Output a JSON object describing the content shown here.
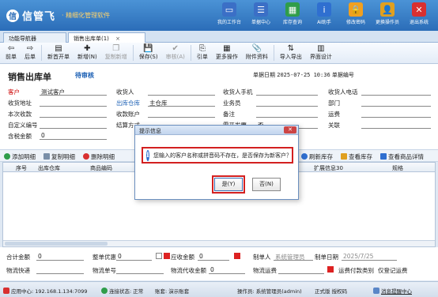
{
  "header": {
    "logo_mark": "信",
    "app_name": "信管飞",
    "tagline": "· 精细化管理软件",
    "tools": [
      {
        "label": "我的工作台",
        "icon": "monitor-icon",
        "color": "#3b6fc6",
        "glyph": "▭"
      },
      {
        "label": "单据中心",
        "icon": "list-icon",
        "color": "#3b6fc6",
        "glyph": "☰"
      },
      {
        "label": "库存查询",
        "icon": "warehouse-icon",
        "color": "#2f9d4a",
        "glyph": "▦"
      },
      {
        "label": "AI助手",
        "icon": "info-icon",
        "color": "#2f6fd0",
        "glyph": "i"
      },
      {
        "label": "修改密码",
        "icon": "lock-icon",
        "color": "#f0a020",
        "glyph": "🔒"
      },
      {
        "label": "更换操作员",
        "icon": "user-icon",
        "color": "#e0a020",
        "glyph": "👤"
      },
      {
        "label": "退出系统",
        "icon": "exit-icon",
        "color": "#d83030",
        "glyph": "✕"
      }
    ]
  },
  "tabs": [
    {
      "label": "功能导航器",
      "active": false
    },
    {
      "label": "销售出库单(1)",
      "active": true,
      "close": "×"
    }
  ],
  "toolbar": [
    {
      "label": "前单",
      "icon": "prev-icon",
      "glyph": "⇦"
    },
    {
      "label": "后单",
      "icon": "next-icon",
      "glyph": "⇨"
    },
    {
      "label": "新首开单",
      "icon": "new-doc-icon",
      "glyph": "▤"
    },
    {
      "label": "新增(N)",
      "icon": "add-icon",
      "glyph": "✚"
    },
    {
      "label": "复制新增",
      "icon": "copy-icon",
      "glyph": "❐",
      "disabled": true
    },
    {
      "label": "保存(S)",
      "icon": "save-icon",
      "glyph": "💾"
    },
    {
      "label": "审核(A)",
      "icon": "audit-icon",
      "glyph": "✔",
      "disabled": true
    },
    {
      "label": "引单",
      "icon": "import-order-icon",
      "glyph": "⎘"
    },
    {
      "label": "更多操作",
      "icon": "more-icon",
      "glyph": "▦"
    },
    {
      "label": "附件资料",
      "icon": "attachment-icon",
      "glyph": "📎"
    },
    {
      "label": "导入导出",
      "icon": "import-export-icon",
      "glyph": "⇅"
    },
    {
      "label": "界面设计",
      "icon": "layout-icon",
      "glyph": "▥"
    }
  ],
  "bill": {
    "title": "销售出库单",
    "status": "待审核",
    "date_label": "单据日期",
    "date_value": "2025-07-25 10:36",
    "number_label": "单据编号"
  },
  "fields": {
    "customer_label": "客户",
    "customer_value": "测试客户",
    "receiver_label": "收货人",
    "receiver_phone_label": "收货人手机",
    "receiver_tel_label": "收货人电话",
    "address_label": "收货地址",
    "warehouse_label": "出库仓库",
    "warehouse_value": "主仓库",
    "salesman_label": "业务员",
    "department_label": "部门",
    "receipt_label": "本次收款",
    "account_label": "收款账户",
    "remark_label": "备注",
    "freight_label": "运费",
    "custom_no_label": "自定义编号",
    "settle_label": "结算方式",
    "tax_label": "需开发票",
    "tax_value": "否",
    "related_label": "关联",
    "tax_amount_label": "含税金额",
    "tax_amount_value": "0"
  },
  "grid_actions": [
    {
      "label": "添加明细",
      "icon": "add-row-icon",
      "color": "#2f9d4a"
    },
    {
      "label": "复制明细",
      "icon": "copy-row-icon",
      "color": "#7a8fa8"
    },
    {
      "label": "删除明细",
      "icon": "delete-row-icon",
      "color": "#d83030"
    },
    {
      "label": "刷新库存",
      "icon": "refresh-icon",
      "color": "#2f6fd0"
    },
    {
      "label": "查看库存",
      "icon": "stock-icon",
      "color": "#e0a020"
    },
    {
      "label": "查看商品详情",
      "icon": "detail-icon",
      "color": "#2f6fd0"
    }
  ],
  "grid_columns": [
    "序号",
    "出库仓库",
    "商品编码",
    "扩展信息30",
    "规格"
  ],
  "sums": {
    "total_label": "合计金额",
    "total_value": "0",
    "discount_label": "整单优惠",
    "discount_value": "0",
    "receivable_label": "应收金额",
    "receivable_value": "0",
    "creator_label": "制单人",
    "creator_value": "系统管理员",
    "create_date_label": "制单日期",
    "create_date_value": "2025/7/25",
    "express_label": "物流快递",
    "tracking_label": "物流单号",
    "cod_label": "物流代收金额",
    "cod_value": "0",
    "shipping_fee_label": "物流运费",
    "register_label": "运费付款类别",
    "register_value": "仅登记运费"
  },
  "status": {
    "app_center": "应用中心: 192.168.1.134:7099",
    "connection": "连接状态: 正常",
    "account": "账套: 演示账套",
    "operator": "操作员: 系统管理员(admin)",
    "edition": "正式版",
    "license": "授权码",
    "message": "消息提醒中心"
  },
  "dialog": {
    "title": "提示信息",
    "close": "✕",
    "message": "您输入的客户名称或拼音码不存在，是否保存为新客户？",
    "yes_label": "是(Y)",
    "no_label": "否(N)"
  }
}
